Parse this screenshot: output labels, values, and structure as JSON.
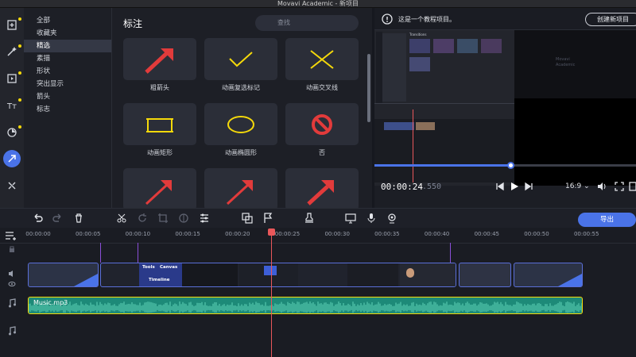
{
  "window": {
    "title": "Movavi Academic - 新项目"
  },
  "categories": {
    "items": [
      "全部",
      "收藏夹",
      "精选",
      "素描",
      "形状",
      "突出显示",
      "箭头",
      "标志"
    ],
    "selected": "精选"
  },
  "grid": {
    "title": "标注",
    "search_placeholder": "查找",
    "tiles": [
      "粗箭头",
      "动画复选标记",
      "动画交叉线",
      "动画矩形",
      "动画椭圆形",
      "否",
      "",
      "",
      ""
    ]
  },
  "preview": {
    "notice": "这是一个教程项目。",
    "new_project_button": "创建新项目",
    "timecode_main": "00:00:24",
    "timecode_frames": ".550",
    "aspect_ratio": "16:9",
    "progress": 0.52,
    "inner_screen": {
      "section": "Transitions",
      "watermark_line1": "Movavi",
      "watermark_line2": "Academic"
    }
  },
  "timeline": {
    "export_button": "导出",
    "ruler": [
      "00:00:00",
      "00:00:05",
      "00:00:10",
      "00:00:15",
      "00:00:20",
      "00:00:25",
      "00:00:30",
      "00:00:35",
      "00:00:40",
      "00:00:45",
      "00:00:50",
      "00:00:55"
    ],
    "video_clip_labels": {
      "tools": "Tools",
      "canvas": "Canvas",
      "timeline": "Timeline"
    },
    "audio_clip": "Music.mp3"
  },
  "colors": {
    "accent": "#4a73e8",
    "playhead": "#e8575a",
    "audio": "#1d8a78",
    "marker": "#f5d90a"
  }
}
